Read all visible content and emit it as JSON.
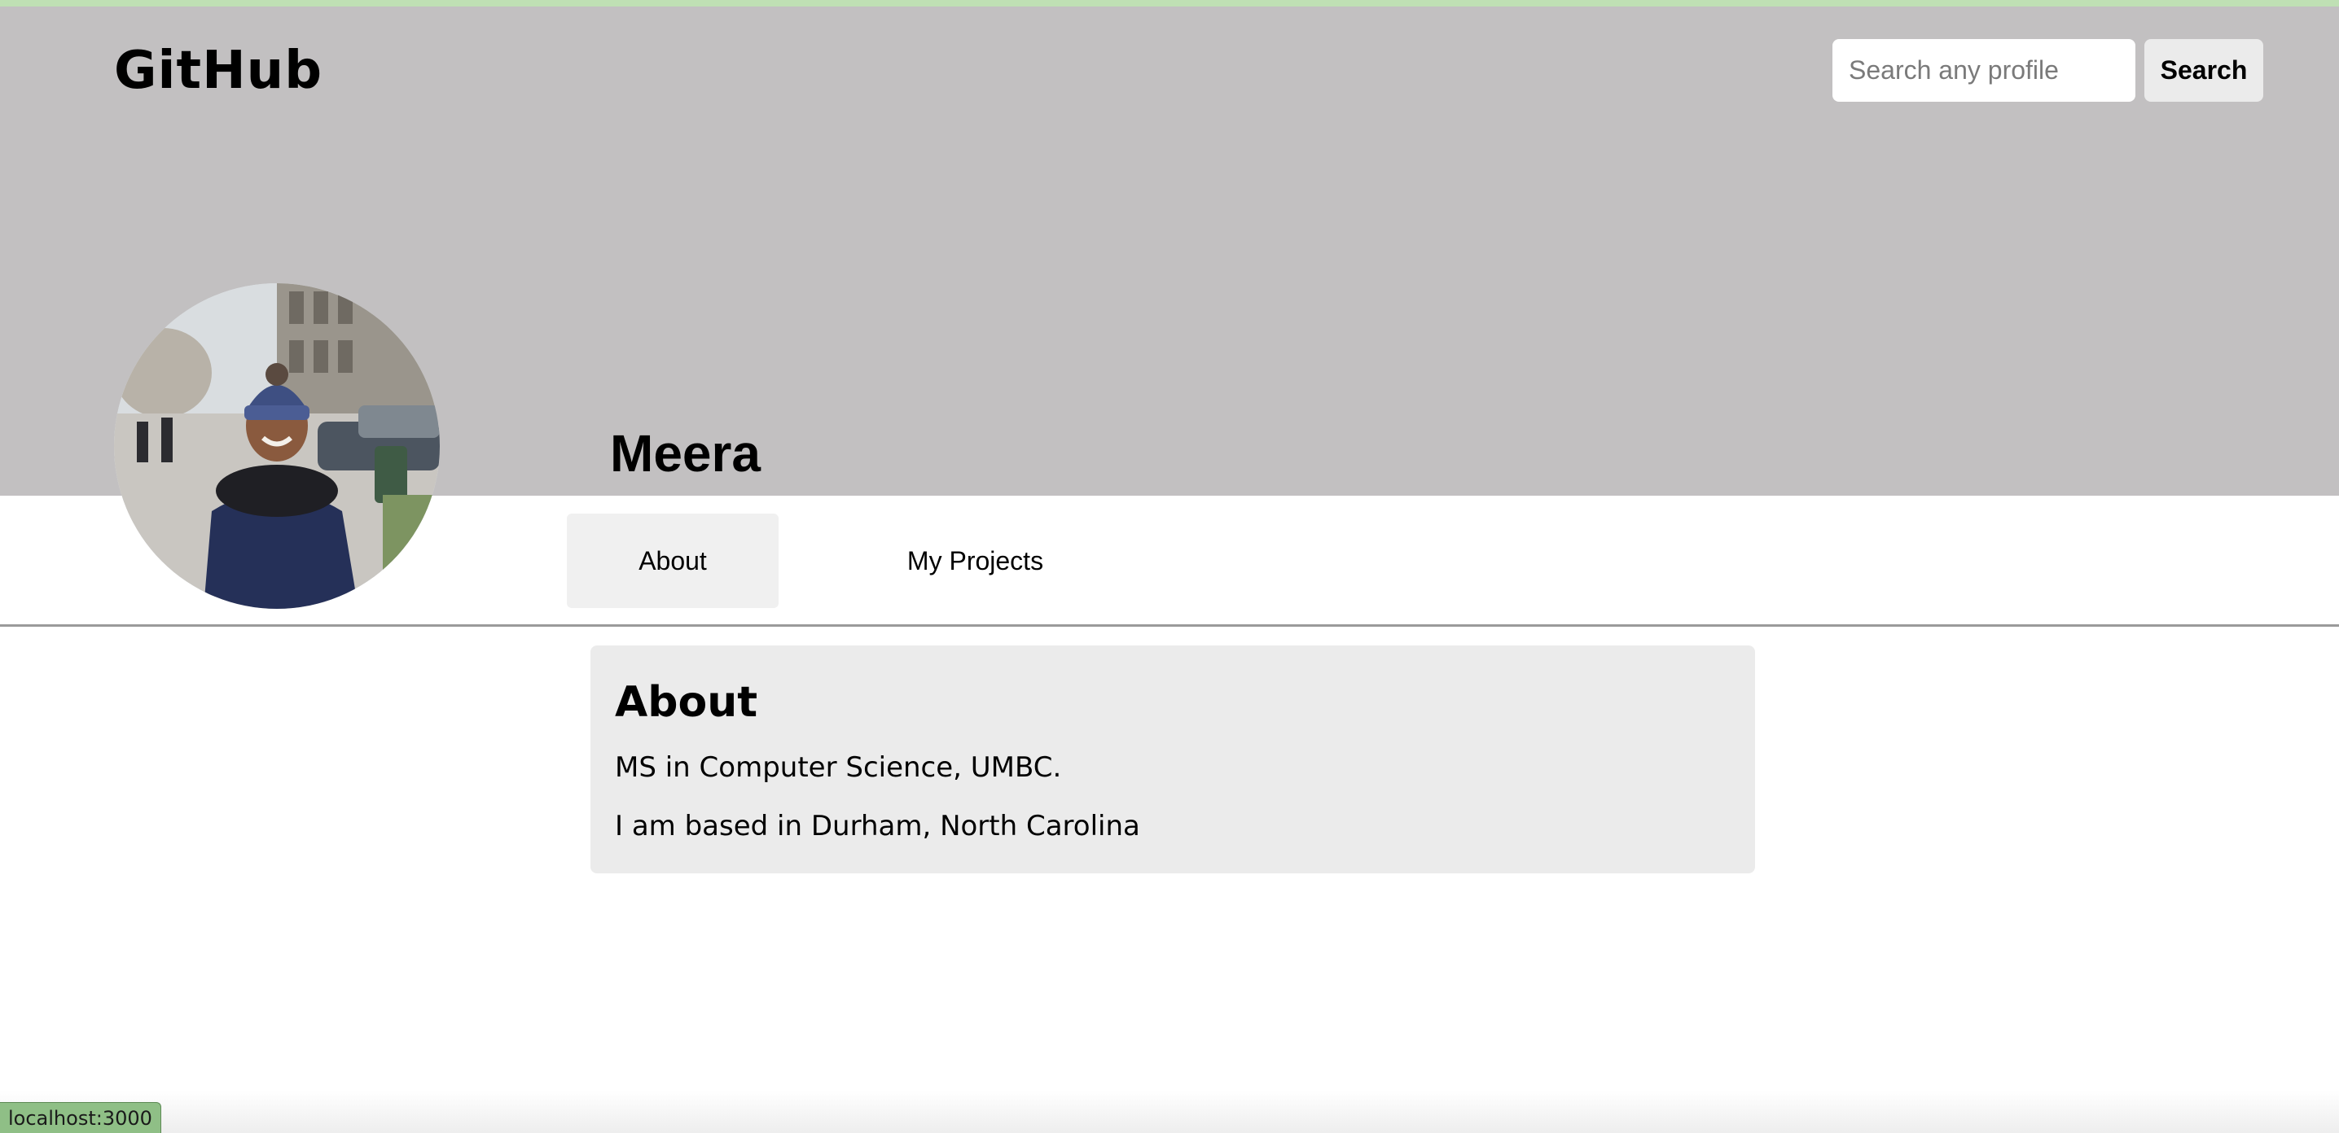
{
  "header": {
    "logo": "GitHub",
    "search_placeholder": "Search any profile",
    "search_value": "",
    "search_button_label": "Search"
  },
  "profile": {
    "name": "Meera",
    "avatar_alt": "profile photo"
  },
  "tabs": [
    {
      "label": "About",
      "active": true
    },
    {
      "label": "My Projects",
      "active": false
    }
  ],
  "about": {
    "title": "About",
    "lines": [
      "MS in Computer Science, UMBC.",
      "I am based in Durham, North Carolina"
    ]
  },
  "status_bar": {
    "url": "localhost:3000"
  },
  "colors": {
    "banner": "#c2c0c1",
    "top_strip": "#bfe0b4",
    "active_tab": "#f0f0f0",
    "card": "#ebebeb",
    "status_bar": "#8fbf86"
  }
}
